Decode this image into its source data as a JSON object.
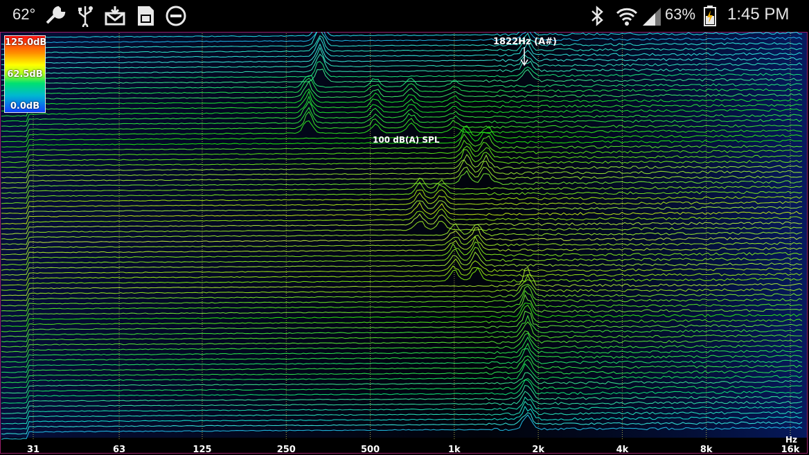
{
  "status_bar": {
    "temperature": "62°",
    "battery_percent": "63%",
    "time": "1:45 PM",
    "left_icons": [
      "wrench-icon",
      "usb-icon",
      "mail-download-icon",
      "sd-card-icon",
      "do-not-disturb-icon"
    ],
    "right_icons": [
      "bluetooth-icon",
      "wifi-icon",
      "signal-icon",
      "battery-charging-icon"
    ]
  },
  "legend": {
    "max": "125.0dB",
    "mid": "62.5dB",
    "min": "0.0dB"
  },
  "annotations": {
    "peak": "1822Hz (A#)",
    "spl": "100 dB(A) SPL"
  },
  "axis": {
    "ticks": [
      {
        "label": "31",
        "hz": 31
      },
      {
        "label": "63",
        "hz": 63
      },
      {
        "label": "125",
        "hz": 125
      },
      {
        "label": "250",
        "hz": 250
      },
      {
        "label": "500",
        "hz": 500
      },
      {
        "label": "1k",
        "hz": 1000
      },
      {
        "label": "2k",
        "hz": 2000
      },
      {
        "label": "4k",
        "hz": 4000
      },
      {
        "label": "8k",
        "hz": 8000
      },
      {
        "label": "16k",
        "hz": 16000
      }
    ],
    "unit": "Hz"
  },
  "colors": {
    "frame": "#9a1e6a",
    "grid": "#e0e060"
  }
}
